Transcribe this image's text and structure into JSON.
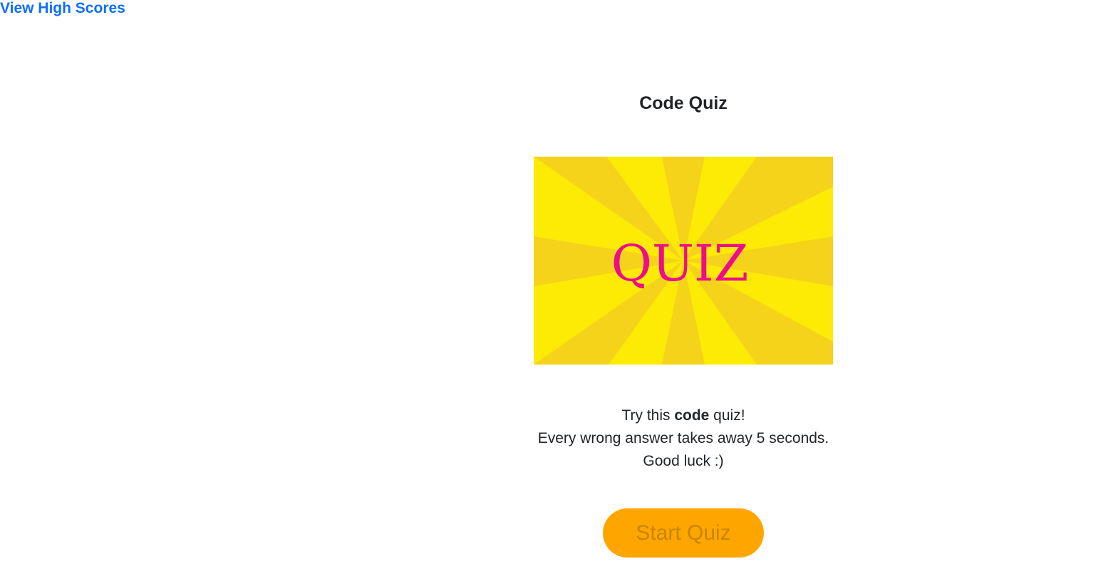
{
  "nav": {
    "high_scores_label": "View High Scores"
  },
  "quiz": {
    "title": "Code Quiz",
    "banner_text": "QUIZ",
    "intro": {
      "line1_before": "Try this ",
      "line1_bold": "code",
      "line1_after": " quiz!",
      "line2": "Every wrong answer takes away 5 seconds.",
      "line3": "Good luck :)"
    },
    "start_label": "Start Quiz"
  },
  "colors": {
    "link": "#0d6efd",
    "button_bg": "#ffa500",
    "button_text": "#c98500",
    "banner_light": "#fdea05",
    "banner_dark": "#f5d31a",
    "banner_text": "#ec0c8c"
  }
}
